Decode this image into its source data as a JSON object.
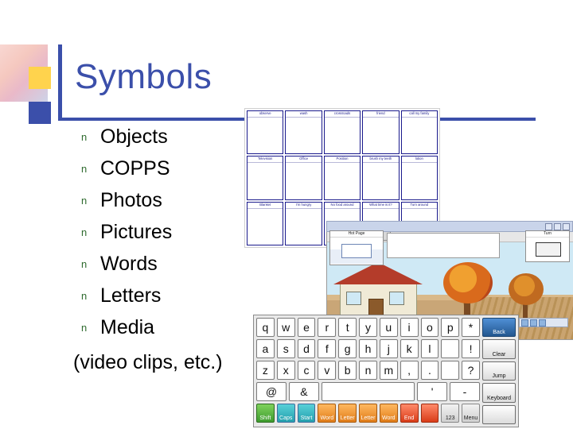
{
  "slide": {
    "title": "Symbols",
    "bullet_marker": "n",
    "bullets": [
      {
        "label": "Objects"
      },
      {
        "label": "COPPS"
      },
      {
        "label": "Photos"
      },
      {
        "label": "Pictures"
      },
      {
        "label": "Words"
      },
      {
        "label": "Letters"
      },
      {
        "label": "Media"
      }
    ],
    "subnote": "(video clips, etc.)",
    "colors": {
      "title": "#3b4faa",
      "rule": "#3b4faa",
      "accent_yellow": "#ffd34d",
      "accent_blue": "#3b4faa",
      "bullet_marker": "#2f6b2f",
      "body_text": "#000000",
      "background": "#ffffff"
    }
  },
  "symbol_grid": {
    "name": "symbol-card-grid",
    "cards": [
      {
        "caption": "observe"
      },
      {
        "caption": "wash"
      },
      {
        "caption": "crossroads"
      },
      {
        "caption": "friend"
      },
      {
        "caption": "call my family"
      },
      {
        "caption": "Television"
      },
      {
        "caption": "Office"
      },
      {
        "caption": "Position"
      },
      {
        "caption": "brush my teeth"
      },
      {
        "caption": "lotion"
      },
      {
        "caption": "Blanket"
      },
      {
        "caption": "I'm hungry"
      },
      {
        "caption": "No food around"
      },
      {
        "caption": "What time is it?"
      },
      {
        "caption": "Turn around"
      }
    ]
  },
  "scene_window": {
    "name": "scene-program-window",
    "hot_page_card": {
      "title": "Hot Page"
    },
    "right_card": {
      "title": "Turn"
    },
    "titlebar_buttons": [
      "minimize",
      "maximize",
      "close"
    ]
  },
  "keyboard": {
    "name": "onscreen-keyboard",
    "rows": [
      [
        "q",
        "w",
        "e",
        "r",
        "t",
        "y",
        "u",
        "i",
        "o",
        "p",
        "*"
      ],
      [
        "a",
        "s",
        "d",
        "f",
        "g",
        "h",
        "j",
        "k",
        "l",
        "!"
      ],
      [
        "z",
        "x",
        "c",
        "v",
        "b",
        "n",
        "m",
        ",",
        ".",
        "?"
      ],
      [
        "@",
        "&",
        "",
        "'",
        "-"
      ]
    ],
    "function_keys": [
      {
        "label": "Shift",
        "color": "green"
      },
      {
        "label": "Caps",
        "color": "teal"
      },
      {
        "label": "Start",
        "color": "teal"
      },
      {
        "label": "Word",
        "color": "orange"
      },
      {
        "label": "Letter",
        "color": "orange"
      },
      {
        "label": "Letter",
        "color": "orange"
      },
      {
        "label": "Word",
        "color": "orange"
      },
      {
        "label": "End",
        "color": "red"
      },
      {
        "label": "",
        "color": "red"
      },
      {
        "label": "123",
        "color": "grey"
      },
      {
        "label": "Menu",
        "color": "grey"
      }
    ],
    "side_keys": [
      {
        "label": "Back",
        "color": "blue"
      },
      {
        "label": "Clear",
        "color": "plain"
      },
      {
        "label": "Jump",
        "color": "plain"
      },
      {
        "label": "Keyboard",
        "color": "plain"
      },
      {
        "label": "",
        "color": "plain"
      }
    ]
  }
}
